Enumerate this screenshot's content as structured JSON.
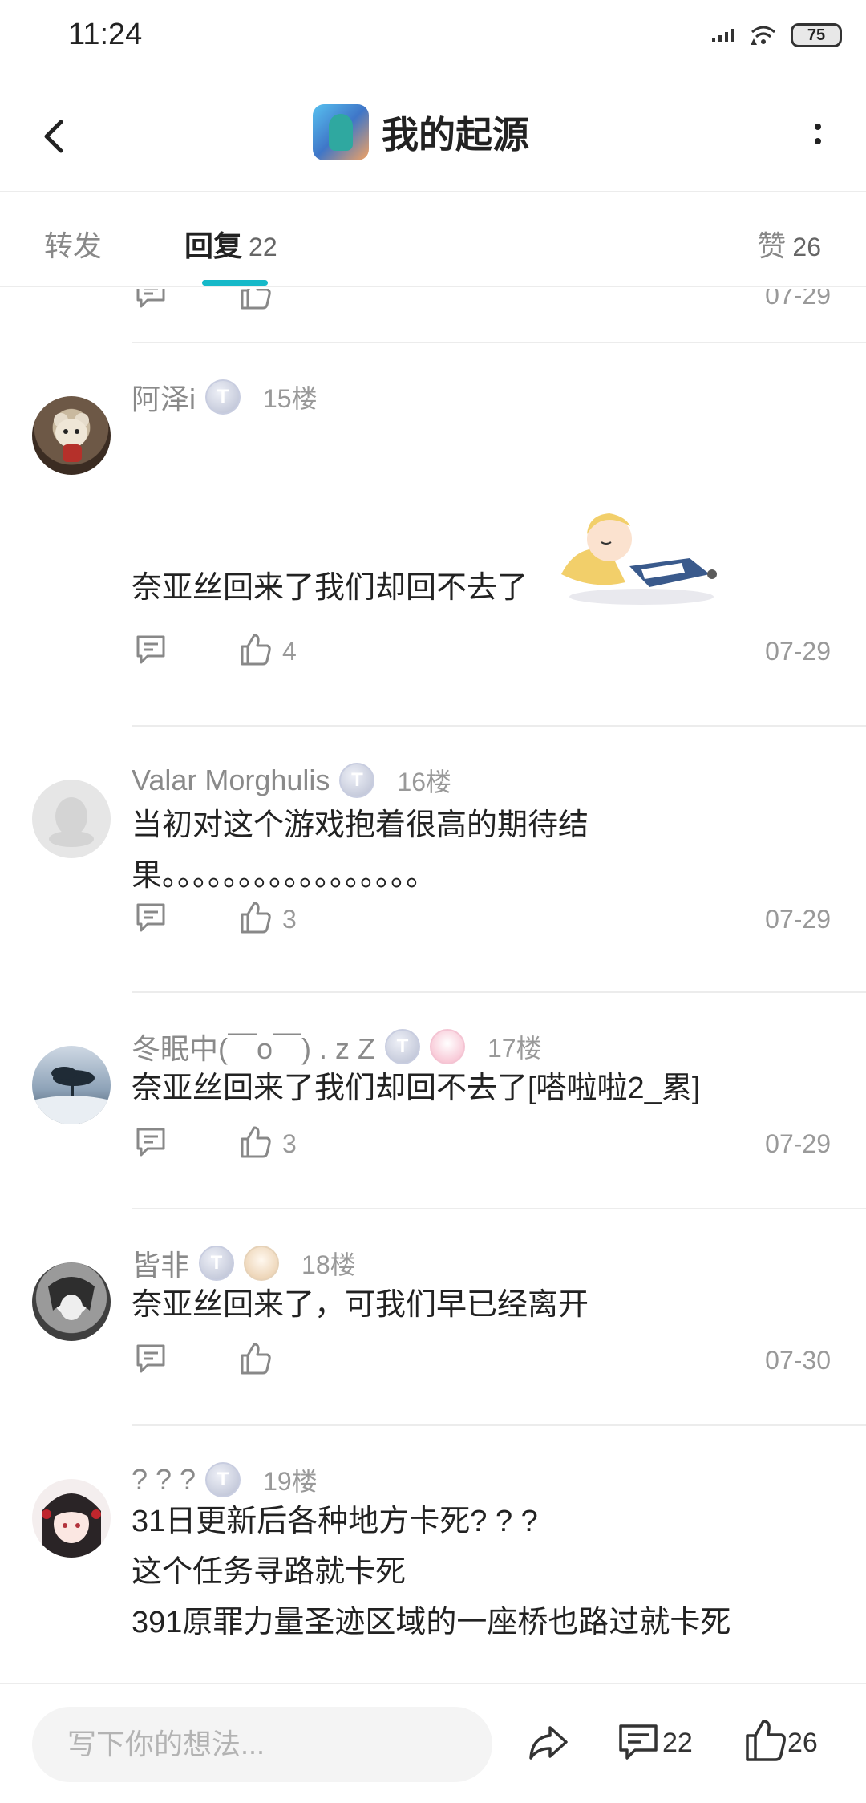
{
  "status_bar": {
    "time": "11:24",
    "battery": "75",
    "icons": [
      "signal-icon",
      "wifi-icon",
      "battery-icon"
    ]
  },
  "header": {
    "title": "我的起源",
    "icons": [
      "back-arrow-icon",
      "app-icon",
      "more-vertical-icon"
    ]
  },
  "tabs": [
    {
      "label": "转发",
      "count": ""
    },
    {
      "label": "回复",
      "count": "22",
      "active": true
    },
    {
      "label": "赞",
      "count": "26"
    }
  ],
  "colors": {
    "accent": "#16b9c9",
    "meta_text": "#999999",
    "author_text": "#8a8a8a"
  },
  "top_partial_row": {
    "likes": "",
    "date": "07-29"
  },
  "posts": [
    {
      "author": "阿泽i",
      "floor": "15楼",
      "text": "奈亚丝回来了我们却回不去了",
      "has_sticker": true,
      "likes": "4",
      "date": "07-29",
      "avatar": "bear-avatar"
    },
    {
      "author": "Valar Morghulis",
      "floor": "16楼",
      "text": "当初对这个游戏抱着很高的期待结果。。。。。。。。。。。。。。。。。",
      "likes": "3",
      "date": "07-29",
      "avatar": "default-avatar"
    },
    {
      "author": "冬眠中(￣o￣) . z Z",
      "floor": "17楼",
      "text": "奈亚丝回来了我们却回不去了[嗒啦啦2_累]",
      "likes": "3",
      "date": "07-29",
      "avatar": "tree-avatar"
    },
    {
      "author": "皆非",
      "floor": "18楼",
      "text": "奈亚丝回来了，可我们早已经离开",
      "likes": "",
      "date": "07-30",
      "avatar": "sketch-avatar"
    },
    {
      "author": "? ? ?",
      "floor": "19楼",
      "lines": [
        "31日更新后各种地方卡死? ? ?",
        "这个任务寻路就卡死",
        "391原罪力量圣迹区域的一座桥也路过就卡死"
      ],
      "avatar": "anime-girl-avatar"
    }
  ],
  "bottom_bar": {
    "placeholder": "写下你的想法...",
    "reply_count": "22",
    "like_count": "26"
  }
}
